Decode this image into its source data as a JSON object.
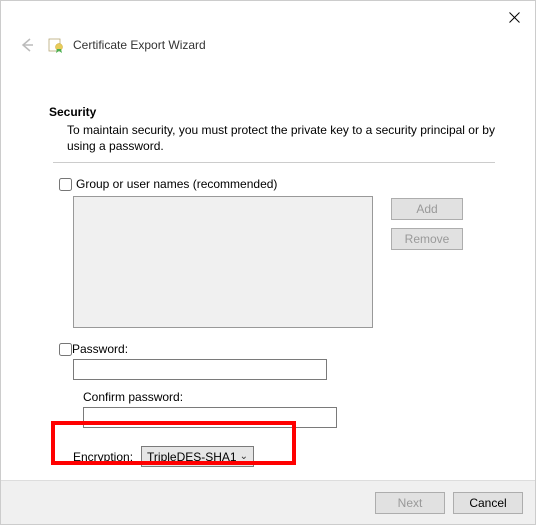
{
  "window": {
    "title": "Certificate Export Wizard"
  },
  "section": {
    "heading": "Security",
    "description": "To maintain security, you must protect the private key to a security principal or by using a password."
  },
  "groups": {
    "label": "Group or user names (recommended)",
    "add": "Add",
    "remove": "Remove"
  },
  "password": {
    "label": "Password:",
    "confirm_label": "Confirm password:"
  },
  "encryption": {
    "label": "Encryption:",
    "value": "TripleDES-SHA1"
  },
  "footer": {
    "next": "Next",
    "cancel": "Cancel"
  }
}
